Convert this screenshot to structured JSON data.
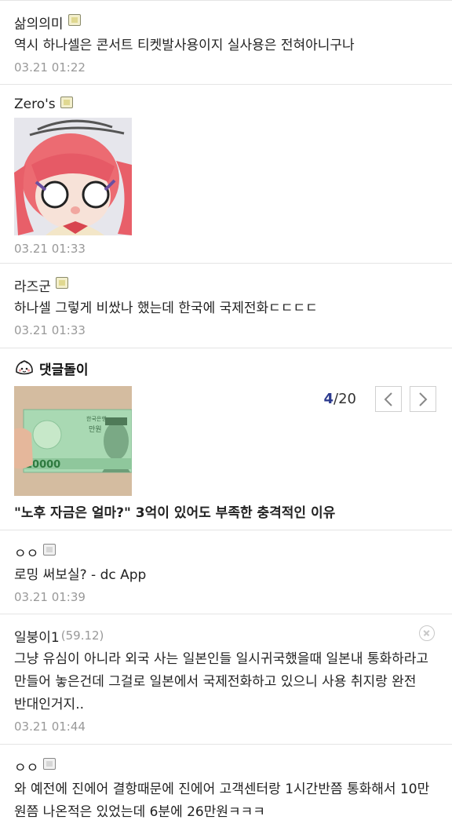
{
  "comments": [
    {
      "nick": "삶의의미",
      "text": "역시 하나셀은 콘서트 티켓발사용이지 실사용은 전혀아니구나",
      "date": "03.21 01:22"
    },
    {
      "nick": "Zero's",
      "date": "03.21 01:33"
    },
    {
      "nick": "라즈군",
      "text": "하나셀 그렇게 비쌌나 했는데 한국에 국제전화ㄷㄷㄷㄷ",
      "date": "03.21 01:33"
    },
    {
      "nick": "ㅇㅇ",
      "text": "로밍 써보실? - dc App",
      "date": "03.21 01:39"
    },
    {
      "nick": "일붕이1",
      "ip": "(59.12)",
      "text": "그냥 유심이 아니라 외국 사는 일본인들 일시귀국했을때 일본내 통화하라고 만들어 놓은건데 그걸로 일본에서 국제전화하고 있으니 사용 취지랑 완전 반대인거지..",
      "date": "03.21 01:44"
    },
    {
      "nick": "ㅇㅇ",
      "text": "와 예전에 진에어 결항때문에 진에어 고객센터랑 1시간반쯤 통화해서 10만원쯤 나온적은 있었는데 6분에 26만원ㅋㅋㅋ"
    }
  ],
  "ad": {
    "brand": "댓글돌이",
    "page_current": "4",
    "page_total": "/20",
    "title": "\"노후 자금은 얼마?\" 3억이 있어도 부족한 충격적인 이유",
    "bill_amount": "10000",
    "bill_label": "만원",
    "bill_bank": "한국은행"
  }
}
